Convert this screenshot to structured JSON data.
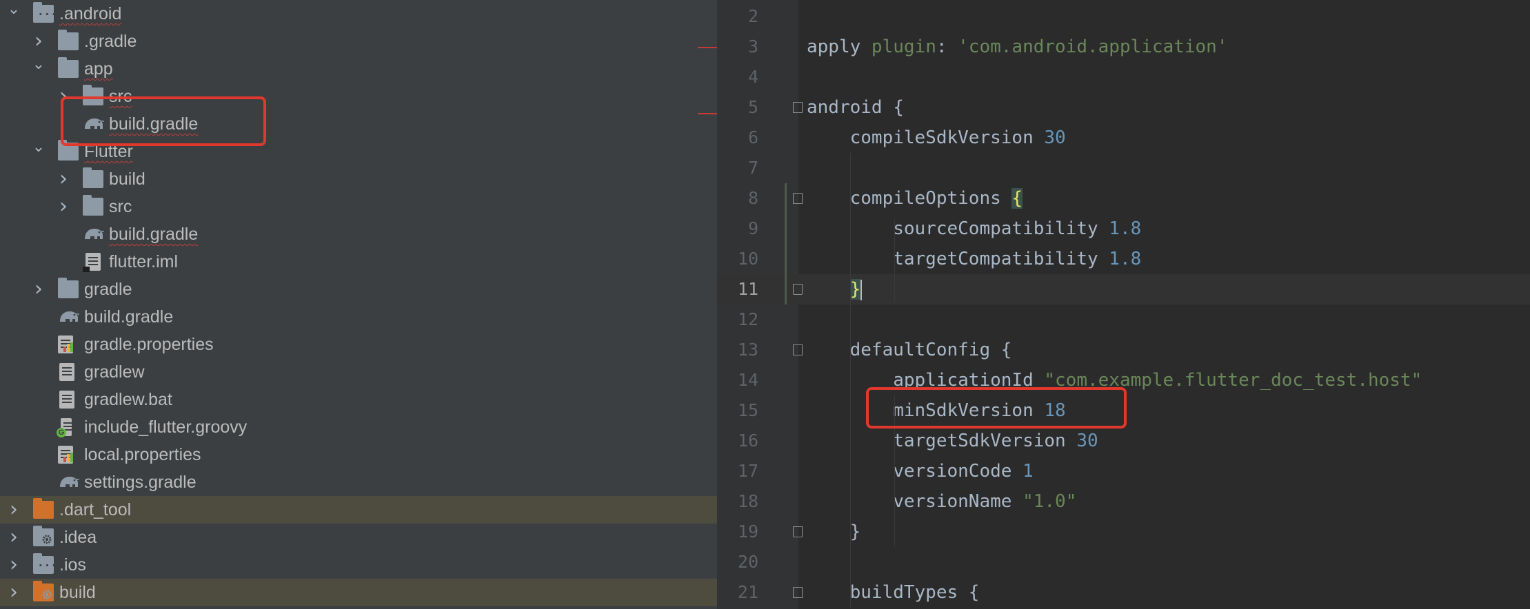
{
  "tree": {
    "rows": [
      {
        "label": ".android",
        "icon": "folder-dots",
        "expanded": true,
        "squiggle": true
      },
      {
        "label": ".gradle",
        "icon": "folder",
        "expanded": false
      },
      {
        "label": "app",
        "icon": "folder",
        "expanded": true,
        "squiggle": true
      },
      {
        "label": "src",
        "icon": "folder",
        "expanded": false,
        "squiggle": true
      },
      {
        "label": "build.gradle",
        "icon": "gradle-elephant",
        "squiggle": true
      },
      {
        "label": "Flutter",
        "icon": "folder",
        "expanded": true,
        "squiggle": true
      },
      {
        "label": "build",
        "icon": "folder",
        "expanded": false
      },
      {
        "label": "src",
        "icon": "folder",
        "expanded": false
      },
      {
        "label": "build.gradle",
        "icon": "gradle-elephant",
        "squiggle": true
      },
      {
        "label": "flutter.iml",
        "icon": "iml-file"
      },
      {
        "label": "gradle",
        "icon": "folder",
        "expanded": false
      },
      {
        "label": "build.gradle",
        "icon": "gradle-elephant"
      },
      {
        "label": "gradle.properties",
        "icon": "properties-file"
      },
      {
        "label": "gradlew",
        "icon": "text-file"
      },
      {
        "label": "gradlew.bat",
        "icon": "text-file"
      },
      {
        "label": "include_flutter.groovy",
        "icon": "groovy-file"
      },
      {
        "label": "local.properties",
        "icon": "properties-file"
      },
      {
        "label": "settings.gradle",
        "icon": "gradle-elephant"
      },
      {
        "label": ".dart_tool",
        "icon": "folder-orange",
        "expanded": false,
        "excluded": true
      },
      {
        "label": ".idea",
        "icon": "folder-gear",
        "expanded": false
      },
      {
        "label": ".ios",
        "icon": "folder-dots",
        "expanded": false
      },
      {
        "label": "build",
        "icon": "folder-orange-gear",
        "expanded": false,
        "excluded": true
      }
    ]
  },
  "editor": {
    "current_line": "11",
    "lines": [
      {
        "n": "2",
        "tokens": []
      },
      {
        "n": "3",
        "tokens": [
          [
            "plain",
            "apply "
          ],
          [
            "str",
            "plugin"
          ],
          [
            "plain",
            ": "
          ],
          [
            "str",
            "'com.android.application'"
          ]
        ]
      },
      {
        "n": "4",
        "tokens": []
      },
      {
        "n": "5",
        "tokens": [
          [
            "plain",
            "android {"
          ]
        ]
      },
      {
        "n": "6",
        "tokens": [
          [
            "plain",
            "    compileSdkVersion "
          ],
          [
            "num",
            "30"
          ]
        ]
      },
      {
        "n": "7",
        "tokens": []
      },
      {
        "n": "8",
        "tokens": [
          [
            "plain",
            "    compileOptions "
          ],
          [
            "brace",
            "{"
          ]
        ]
      },
      {
        "n": "9",
        "tokens": [
          [
            "plain",
            "        sourceCompatibility "
          ],
          [
            "num",
            "1.8"
          ]
        ]
      },
      {
        "n": "10",
        "tokens": [
          [
            "plain",
            "        targetCompatibility "
          ],
          [
            "num",
            "1.8"
          ]
        ]
      },
      {
        "n": "11",
        "tokens": [
          [
            "plain",
            "    "
          ],
          [
            "brace",
            "}"
          ]
        ]
      },
      {
        "n": "12",
        "tokens": []
      },
      {
        "n": "13",
        "tokens": [
          [
            "plain",
            "    defaultConfig {"
          ]
        ]
      },
      {
        "n": "14",
        "tokens": [
          [
            "plain",
            "        applicationId "
          ],
          [
            "str",
            "\"com.example.flutter_doc_test.host\""
          ]
        ]
      },
      {
        "n": "15",
        "tokens": [
          [
            "plain",
            "        minSdkVersion "
          ],
          [
            "num",
            "18"
          ]
        ]
      },
      {
        "n": "16",
        "tokens": [
          [
            "plain",
            "        targetSdkVersion "
          ],
          [
            "num",
            "30"
          ]
        ]
      },
      {
        "n": "17",
        "tokens": [
          [
            "plain",
            "        versionCode "
          ],
          [
            "num",
            "1"
          ]
        ]
      },
      {
        "n": "18",
        "tokens": [
          [
            "plain",
            "        versionName "
          ],
          [
            "str",
            "\"1.0\""
          ]
        ]
      },
      {
        "n": "19",
        "tokens": [
          [
            "plain",
            "    }"
          ]
        ]
      },
      {
        "n": "20",
        "tokens": []
      },
      {
        "n": "21",
        "tokens": [
          [
            "plain",
            "    buildTypes {"
          ]
        ]
      }
    ]
  },
  "colors": {
    "highlight": "#e1382d",
    "string": "#6a8759",
    "number": "#6897bb",
    "text": "#a9b7c6"
  }
}
